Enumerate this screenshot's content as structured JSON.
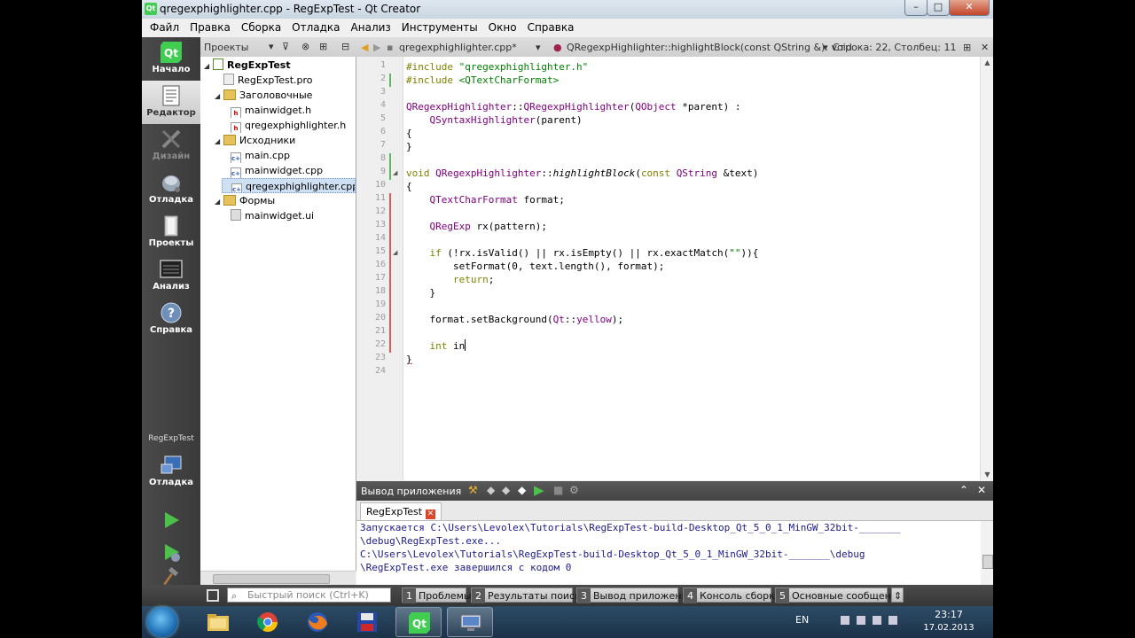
{
  "window": {
    "title": "qregexphighlighter.cpp - RegExpTest - Qt Creator",
    "app_icon": "Qt",
    "controls": {
      "minimize": "–",
      "maximize": "□",
      "close": "✕"
    }
  },
  "menu": [
    "Файл",
    "Правка",
    "Сборка",
    "Отладка",
    "Анализ",
    "Инструменты",
    "Окно",
    "Справка"
  ],
  "modes": [
    {
      "label": "Начало",
      "icon": "qt-logo-icon"
    },
    {
      "label": "Редактор",
      "icon": "editor-icon"
    },
    {
      "label": "Дизайн",
      "icon": "design-icon"
    },
    {
      "label": "Отладка",
      "icon": "debug-icon"
    },
    {
      "label": "Проекты",
      "icon": "projects-icon"
    },
    {
      "label": "Анализ",
      "icon": "analyze-icon"
    },
    {
      "label": "Справка",
      "icon": "help-icon"
    }
  ],
  "kit": {
    "name": "RegExpTest",
    "mode": "Отладка"
  },
  "projects_pane": {
    "title": "Проекты",
    "tree": [
      {
        "label": "RegExpTest",
        "level": 0,
        "type": "project",
        "arrow": "◢"
      },
      {
        "label": "RegExpTest.pro",
        "level": 1,
        "type": "pro"
      },
      {
        "label": "Заголовочные",
        "level": 1,
        "type": "folder",
        "arrow": "◢"
      },
      {
        "label": "mainwidget.h",
        "level": 2,
        "type": "h"
      },
      {
        "label": "qregexphighlighter.h",
        "level": 2,
        "type": "h"
      },
      {
        "label": "Исходники",
        "level": 1,
        "type": "folder",
        "arrow": "◢"
      },
      {
        "label": "main.cpp",
        "level": 2,
        "type": "cpp"
      },
      {
        "label": "mainwidget.cpp",
        "level": 2,
        "type": "cpp"
      },
      {
        "label": "qregexphighlighter.cpp",
        "level": 2,
        "type": "cpp",
        "selected": true
      },
      {
        "label": "Формы",
        "level": 1,
        "type": "folder",
        "arrow": "◢"
      },
      {
        "label": "mainwidget.ui",
        "level": 2,
        "type": "ui"
      }
    ]
  },
  "editor": {
    "file_tab": "qregexphighlighter.cpp*",
    "symbol": "QRegexpHighlighter::highlightBlock(const QString &): void",
    "position": "Строка: 22, Столбец: 11",
    "line_numbers": [
      "1",
      "2",
      "3",
      "4",
      "5",
      "6",
      "7",
      "8",
      "9",
      "10",
      "11",
      "12",
      "13",
      "14",
      "15",
      "16",
      "17",
      "18",
      "19",
      "20",
      "21",
      "22",
      "23",
      "24"
    ],
    "code": {
      "l1_kw": "#include",
      "l1_str": " \"qregexphighlighter.h\"",
      "l2_kw": "#include",
      "l2_str": " <QTextCharFormat>",
      "l4_a": "QRegexpHighlighter",
      "l4_b": "::",
      "l4_c": "QRegexpHighlighter",
      "l4_d": "(",
      "l4_e": "QObject",
      "l4_f": " *parent) :",
      "l5_a": "    QSyntaxHighlighter",
      "l5_b": "(parent)",
      "l6": "{",
      "l7": "}",
      "l9_kw": "void",
      "l9_a": " QRegexpHighlighter",
      "l9_b": "::",
      "l9_c": "highlightBlock",
      "l9_d": "(",
      "l9_e": "const",
      "l9_f": " ",
      "l9_g": "QString",
      "l9_h": " &text)",
      "l10": "{",
      "l11_a": "    QTextCharFormat",
      "l11_b": " format;",
      "l13_a": "    QRegExp",
      "l13_b": " rx(pattern);",
      "l15_kw": "    if",
      "l15_b": " (!rx.isValid() || rx.isEmpty() || rx.exactMatch(",
      "l15_str": "\"\"",
      "l15_c": ")){",
      "l16": "        setFormat(0, text.length(), format);",
      "l17_kw": "        return",
      "l17_b": ";",
      "l18": "    }",
      "l20_a": "    format.setBackground(",
      "l20_b": "Qt",
      "l20_c": "::",
      "l20_d": "yellow",
      "l20_e": ");",
      "l22_kw": "    int",
      "l22_b": " in",
      "l23": "}"
    }
  },
  "output": {
    "title": "Вывод приложения",
    "tab": "RegExpTest",
    "lines": [
      "Запускается C:\\Users\\Levolex\\Tutorials\\RegExpTest-build-Desktop_Qt_5_0_1_MinGW_32bit-_______",
      "\\debug\\RegExpTest.exe...",
      "C:\\Users\\Levolex\\Tutorials\\RegExpTest-build-Desktop_Qt_5_0_1_MinGW_32bit-_______\\debug",
      "\\RegExpTest.exe завершился с кодом 0"
    ]
  },
  "statusbar": {
    "search_placeholder": "Быстрый поиск (Ctrl+K)",
    "panes": [
      {
        "num": "1",
        "label": "Проблемы"
      },
      {
        "num": "2",
        "label": "Результаты поиска"
      },
      {
        "num": "3",
        "label": "Вывод приложения"
      },
      {
        "num": "4",
        "label": "Консоль сборки"
      },
      {
        "num": "5",
        "label": "Основные сообщения"
      }
    ]
  },
  "taskbar": {
    "apps": [
      "explorer-icon",
      "chrome-icon",
      "firefox-icon",
      "floppy-icon",
      "qt-creator-icon",
      "remote-desktop-icon"
    ],
    "lang": "EN",
    "time": "23:17",
    "date": "17.02.2013"
  },
  "colors": {
    "keyword": "#808000",
    "string": "#008000",
    "class": "#800080",
    "modified_marker": "#e05a5a",
    "saved_marker": "#5fb85f"
  }
}
